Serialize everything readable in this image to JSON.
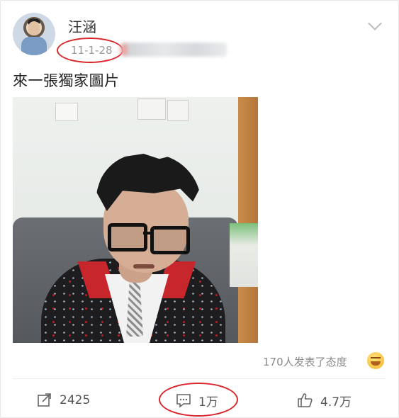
{
  "post": {
    "username": "汪涵",
    "timestamp": "11-1-28",
    "text": "來一張獨家圖片",
    "reaction_summary": "170人发表了态度",
    "menu_icon": "chevron-down-icon",
    "emoji_icon": "laughing-face-icon"
  },
  "actions": {
    "share_count": "2425",
    "comment_count": "1万",
    "like_count": "4.7万"
  },
  "colors": {
    "annotation_red": "#d9262b",
    "text_secondary": "#9a9a9a"
  }
}
